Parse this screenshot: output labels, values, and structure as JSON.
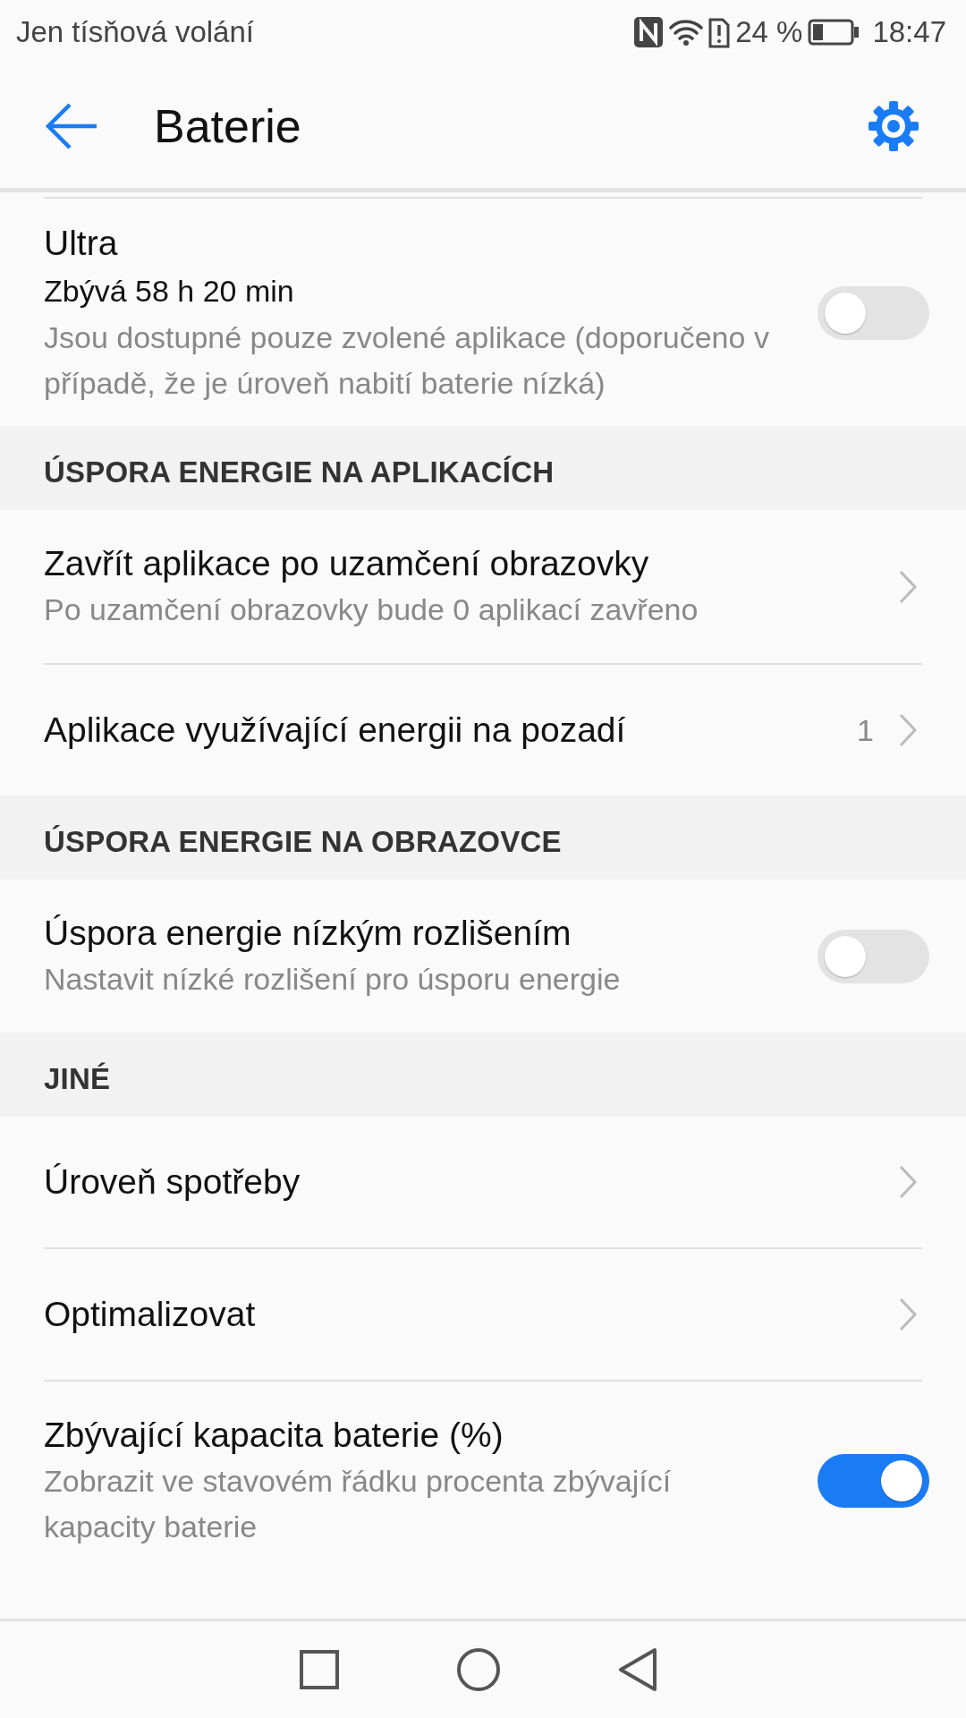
{
  "status_bar": {
    "carrier": "Jen tísňová volání",
    "battery": "24 %",
    "time": "18:47"
  },
  "app_bar": {
    "title": "Baterie"
  },
  "sections": [
    {
      "items": [
        {
          "kind": "toggle",
          "title": "Ultra",
          "subtitle": "Zbývá 58 h 20 min",
          "description": "Jsou dostupné pouze zvolené aplikace (doporučeno v případě, že je úroveň nabití baterie nízká)",
          "on": false
        }
      ]
    },
    {
      "header": "ÚSPORA ENERGIE NA APLIKACÍCH",
      "items": [
        {
          "kind": "nav",
          "title": "Zavřít aplikace po uzamčení obrazovky",
          "description": "Po uzamčení obrazovky bude 0 aplikací zavřeno"
        },
        {
          "kind": "nav",
          "title": "Aplikace využívající energii na pozadí",
          "value": "1"
        }
      ]
    },
    {
      "header": "ÚSPORA ENERGIE NA OBRAZOVCE",
      "items": [
        {
          "kind": "toggle",
          "title": "Úspora energie nízkým rozlišením",
          "description": "Nastavit nízké rozlišení pro úsporu energie",
          "on": false
        }
      ]
    },
    {
      "header": "JINÉ",
      "items": [
        {
          "kind": "nav",
          "title": "Úroveň spotřeby"
        },
        {
          "kind": "nav",
          "title": "Optimalizovat"
        },
        {
          "kind": "toggle",
          "title": "Zbývající kapacita baterie (%)",
          "description": "Zobrazit ve stavovém řádku procenta zbývající kapacity baterie",
          "on": true
        }
      ]
    }
  ]
}
